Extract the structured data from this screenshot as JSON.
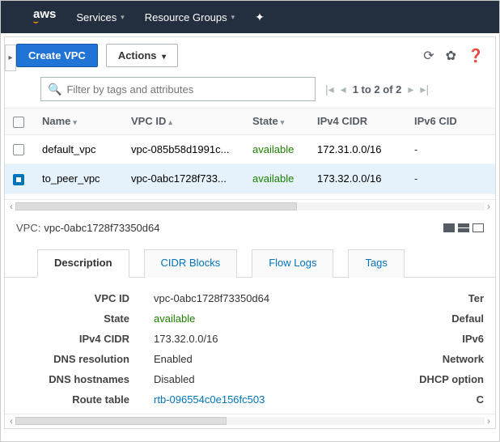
{
  "nav": {
    "logo_text": "aws",
    "services": "Services",
    "resource_groups": "Resource Groups"
  },
  "toolbar": {
    "create_vpc": "Create VPC",
    "actions": "Actions"
  },
  "filter": {
    "placeholder": "Filter by tags and attributes",
    "pager_label": "1 to 2 of 2"
  },
  "columns": {
    "name": "Name",
    "vpc_id": "VPC ID",
    "state": "State",
    "ipv4": "IPv4 CIDR",
    "ipv6": "IPv6 CID"
  },
  "rows": [
    {
      "selected": false,
      "name": "default_vpc",
      "vpc_id": "vpc-085b58d1991c...",
      "state": "available",
      "ipv4": "172.31.0.0/16",
      "ipv6": "-"
    },
    {
      "selected": true,
      "name": "to_peer_vpc",
      "vpc_id": "vpc-0abc1728f733...",
      "state": "available",
      "ipv4": "173.32.0.0/16",
      "ipv6": "-"
    }
  ],
  "detail": {
    "prefix": "VPC:",
    "title": "vpc-0abc1728f73350d64",
    "tabs": {
      "description": "Description",
      "cidr_blocks": "CIDR Blocks",
      "flow_logs": "Flow Logs",
      "tags": "Tags"
    },
    "labels": {
      "vpc_id": "VPC ID",
      "state": "State",
      "ipv4": "IPv4 CIDR",
      "dns_res": "DNS resolution",
      "dns_host": "DNS hostnames",
      "route_table": "Route table"
    },
    "values": {
      "vpc_id": "vpc-0abc1728f73350d64",
      "state": "available",
      "ipv4": "173.32.0.0/16",
      "dns_res": "Enabled",
      "dns_host": "Disabled",
      "route_table": "rtb-096554c0e156fc503"
    },
    "rlabels": {
      "tenancy": "Ter",
      "default": "Defaul",
      "ipv6": "IPv6",
      "network": "Network",
      "dhcp": "DHCP option",
      "c": "C"
    }
  }
}
